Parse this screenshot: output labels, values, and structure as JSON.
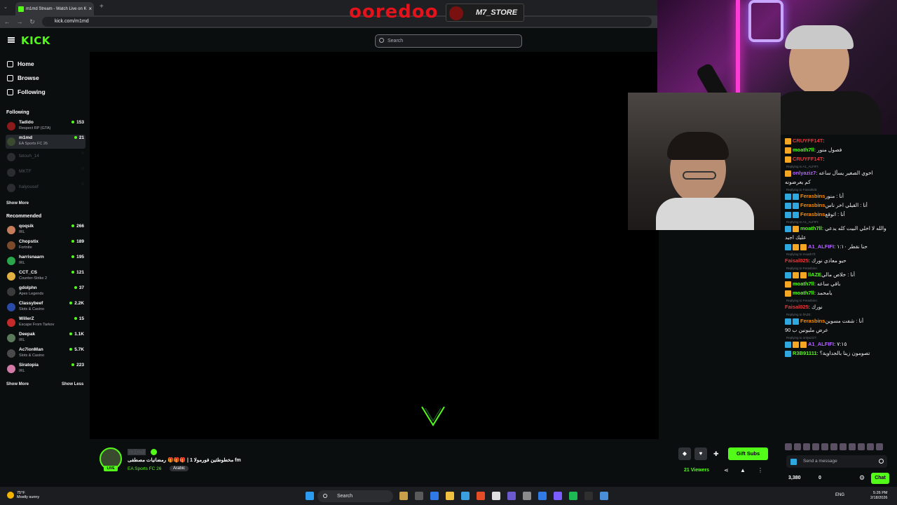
{
  "browser": {
    "tab_title": "m1md Stream - Watch Live on K",
    "new_tab": "+",
    "url": "kick.com/m1md"
  },
  "overlay": {
    "ad1": "ooredoo",
    "ad2": "M7_STORE"
  },
  "header": {
    "logo": "KICK",
    "search_placeholder": "Search"
  },
  "sidebar": {
    "nav": [
      {
        "label": "Home",
        "icon": "home-icon"
      },
      {
        "label": "Browse",
        "icon": "compass-icon"
      },
      {
        "label": "Following",
        "icon": "heart-icon"
      }
    ],
    "following_title": "Following",
    "following": [
      {
        "name": "Tadido",
        "category": "Respect RP (GTA)",
        "viewers": "153",
        "color": "#8b1a1a"
      },
      {
        "name": "m1md",
        "category": "EA Sports FC 26",
        "viewers": "21",
        "color": "#3a4a2e"
      },
      {
        "name": "fatouh_14",
        "category": "",
        "viewers": "",
        "color": "#2a2c30"
      },
      {
        "name": "MKTF",
        "category": "",
        "viewers": "",
        "color": "#2a2c30"
      },
      {
        "name": "halyousef",
        "category": "",
        "viewers": "",
        "color": "#2a2c30"
      }
    ],
    "show_more_1": "Show More",
    "recommended_title": "Recommended",
    "recommended": [
      {
        "name": "qoqsik",
        "category": "IRL",
        "viewers": "266",
        "color": "#c47c5a"
      },
      {
        "name": "Chopstix",
        "category": "Fortnite",
        "viewers": "189",
        "color": "#7a4a2a"
      },
      {
        "name": "harrisnaarn",
        "category": "IRL",
        "viewers": "195",
        "color": "#2aa54a"
      },
      {
        "name": "CCT_CS",
        "category": "Counter-Strike 2",
        "viewers": "121",
        "color": "#e0b040"
      },
      {
        "name": "gdolphn",
        "category": "Apex Legends",
        "viewers": "37",
        "color": "#3a3a3a"
      },
      {
        "name": "Classybeef",
        "category": "Slots & Casino",
        "viewers": "2.2K",
        "color": "#2a4aa5"
      },
      {
        "name": "WillerZ",
        "category": "Escape From Tarkov",
        "viewers": "15",
        "color": "#c42a2a"
      },
      {
        "name": "Deepak",
        "category": "IRL",
        "viewers": "1.1K",
        "color": "#5a7a5a"
      },
      {
        "name": "Ac7ionMan",
        "category": "Slots & Casino",
        "viewers": "5.7K",
        "color": "#4a4a4a"
      },
      {
        "name": "Siratopia",
        "category": "IRL",
        "viewers": "223",
        "color": "#d07aa5"
      }
    ],
    "show_more_2": "Show More",
    "show_less": "Show Less"
  },
  "stream": {
    "streamer": "m1md",
    "live": "LIVE",
    "title": "مخطوطتين فورمولا 1 | 🎁🎁🎁 رمضانيات مصطفى fm",
    "category": "EA Sports FC 26",
    "language": "Arabic",
    "viewers": "21 Viewers",
    "gift_subs": "Gift Subs"
  },
  "chat": {
    "messages": [
      {
        "reply": "",
        "badges": [
          "#f5a623"
        ],
        "user": "CRUYFF14T",
        "color": "#e5383b",
        "text": ":"
      },
      {
        "reply": "",
        "badges": [
          "#f5a623"
        ],
        "user": "moath7ll",
        "color": "#53fc18",
        "text": ": فصول منور"
      },
      {
        "reply": "",
        "badges": [
          "#f5a623"
        ],
        "user": "CRUYFF14T",
        "color": "#e5383b",
        "text": ":"
      },
      {
        "reply": "Replying to A1_ALFIFI:",
        "badges": [
          "#f5a623"
        ],
        "user": "onlyaziz7",
        "color": "#b362ff",
        "text": ": اخوي الصغير يسأل ساعه"
      },
      {
        "reply": "",
        "badges": [],
        "user": "",
        "color": "#efeff1",
        "text": "كم يعرضونه"
      },
      {
        "reply": "Replying to Faisal025:",
        "badges": [
          "#2fa8e0",
          "#2fa8e0"
        ],
        "user": "Ferasbins",
        "color": "#ff8a00",
        "text": "أنا : منور"
      },
      {
        "reply": "",
        "badges": [
          "#2fa8e0",
          "#2fa8e0"
        ],
        "user": "Ferasbins",
        "color": "#ff8a00",
        "text": "أنا : القيلي اخر ناس"
      },
      {
        "reply": "",
        "badges": [
          "#2fa8e0",
          "#2fa8e0"
        ],
        "user": "Ferasbins",
        "color": "#ff8a00",
        "text": "أنا : اتوقع"
      },
      {
        "reply": "Replying to A1_ALFIFI:",
        "badges": [
          "#2fa8e0",
          "#f5a623"
        ],
        "user": "moath7ll",
        "color": "#53fc18",
        "text": ": والله لا اخلي البيت كله يدعي"
      },
      {
        "reply": "",
        "badges": [],
        "user": "",
        "color": "#efeff1",
        "text": "عليك اجيد"
      },
      {
        "reply": "",
        "badges": [
          "#2fa8e0",
          "#f5a623",
          "#f5a623"
        ],
        "user": "A1_ALFIFI",
        "color": "#b362ff",
        "text": ": حنا نقطر ١:١٠"
      },
      {
        "reply": "Replying to moath7ll:",
        "badges": [],
        "user": "Faisal025",
        "color": "#e5383b",
        "text": ": حيو معاذي نورك"
      },
      {
        "reply": "Replying to Ferasbins:",
        "badges": [
          "#2fa8e0",
          "#f5a623",
          "#f5a623"
        ],
        "user": "llAZE",
        "color": "#53fc18",
        "text": "أنا : خلاص مالي"
      },
      {
        "reply": "",
        "badges": [
          "#f5a623"
        ],
        "user": "moath7ll",
        "color": "#53fc18",
        "text": ": باقي ساعه"
      },
      {
        "reply": "",
        "badges": [
          "#f5a623"
        ],
        "user": "moath7ll",
        "color": "#53fc18",
        "text": ": يامحمد"
      },
      {
        "reply": "Replying to Ferasbins:",
        "badges": [],
        "user": "Faisal025",
        "color": "#e5383b",
        "text": ": نورك"
      },
      {
        "reply": "Replying to llAZE:",
        "badges": [
          "#2fa8e0",
          "#2fa8e0"
        ],
        "user": "Ferasbins",
        "color": "#ff8a00",
        "text": "أنا : شفت مسوين"
      },
      {
        "reply": "",
        "badges": [],
        "user": "",
        "color": "#efeff1",
        "text": "عرض مليونين ب 90"
      },
      {
        "reply": "Replying to onlyaziz7:",
        "badges": [
          "#2fa8e0",
          "#f5a623",
          "#f5a623"
        ],
        "user": "A1_ALFIFI",
        "color": "#b362ff",
        "text": ": ٧:١٥"
      },
      {
        "reply": "",
        "badges": [
          "#2fa8e0"
        ],
        "user": "R3B91111",
        "color": "#53fc18",
        "text": ": تصومون زينا بالجداوية؟"
      }
    ],
    "input_placeholder": "Send a message",
    "points": "3,380",
    "count": "0",
    "chat_button": "Chat"
  },
  "taskbar": {
    "temp": "75°F",
    "condition": "Mostly sunny",
    "search": "Search",
    "lang": "ENG",
    "time": "5:26 PM",
    "date": "2/18/2026"
  }
}
